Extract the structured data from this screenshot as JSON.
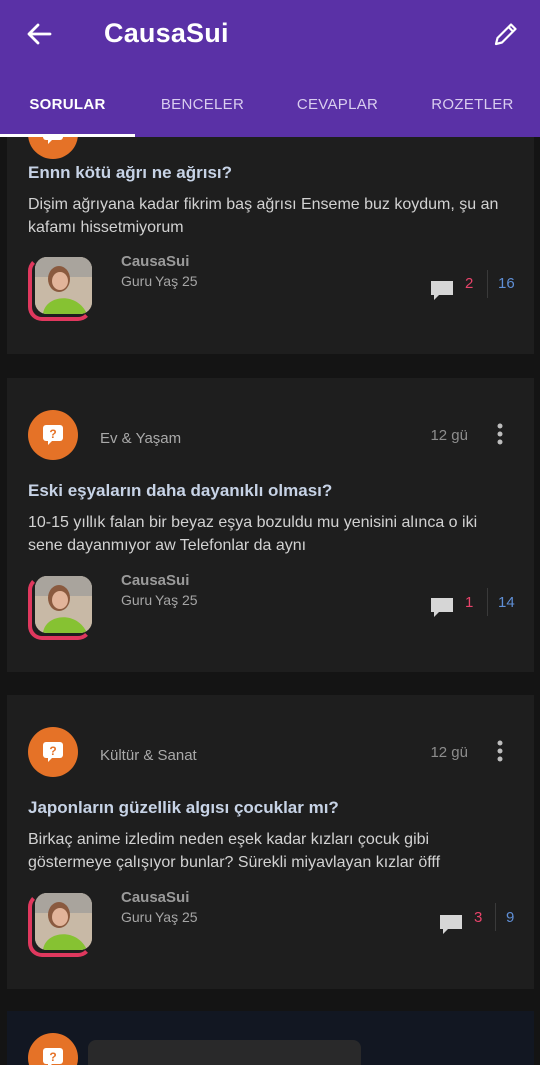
{
  "app": {
    "title": "CausaSui",
    "tabs": [
      {
        "label": "SORULAR",
        "active": true
      },
      {
        "label": "BENCELER",
        "active": false
      },
      {
        "label": "CEVAPLAR",
        "active": false
      },
      {
        "label": "ROZETLER",
        "active": false
      }
    ],
    "icons": {
      "back": "back-arrow-icon",
      "edit": "pencil-icon"
    },
    "colors": {
      "header": "#5a31a6",
      "category_icon": "#e57227",
      "comment_count": "#e8436a",
      "like_count": "#5f8fd6",
      "avatar_ring": "#e0385e"
    }
  },
  "questions": [
    {
      "category": "",
      "time": "",
      "title": "Ennn kötü ağrı ne ağrısı?",
      "body": "Dişim ağrıyana kadar fikrim baş ağrısı Enseme buz koydum, şu an kafamı hissetmiyorum",
      "author": {
        "name": "CausaSui",
        "rank": "Guru",
        "age": "Yaş 25"
      },
      "comments": "2",
      "likes": "16"
    },
    {
      "category": "Ev & Yaşam",
      "time": "12 gü",
      "title": "Eski eşyaların daha dayanıklı olması?",
      "body": "10-15 yıllık falan bir beyaz eşya bozuldu mu yenisini alınca o iki sene dayanmıyor aw Telefonlar da aynı",
      "author": {
        "name": "CausaSui",
        "rank": "Guru",
        "age": "Yaş 25"
      },
      "comments": "1",
      "likes": "14"
    },
    {
      "category": "Kültür & Sanat",
      "time": "12 gü",
      "title": "Japonların güzellik algısı çocuklar mı?",
      "body": "Birkaç anime izledim neden eşek kadar kızları çocuk gibi göstermeye çalışıyor bunlar? Sürekli miyavlayan kızlar öfff",
      "author": {
        "name": "CausaSui",
        "rank": "Guru",
        "age": "Yaş 25"
      },
      "comments": "3",
      "likes": "9"
    }
  ]
}
